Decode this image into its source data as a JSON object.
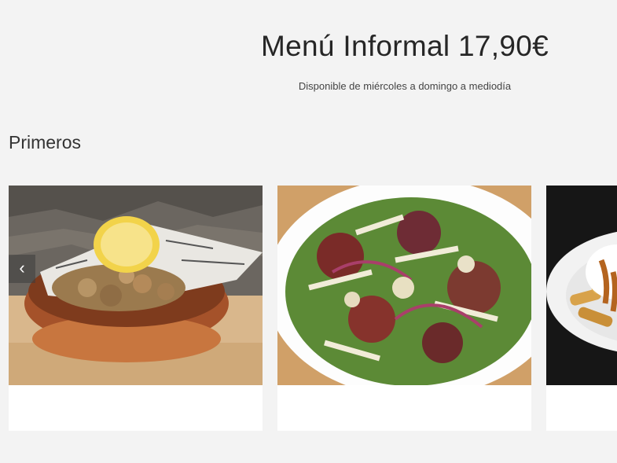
{
  "menu": {
    "title": "Menú Informal 17,90€",
    "subtitle": "Disponible de miércoles a domingo a mediodía"
  },
  "section": {
    "heading": "Primeros"
  },
  "carousel": {
    "prev_icon": "chevron-left-icon",
    "prev_glyph": "‹",
    "items": [
      {
        "label": "",
        "image": "fried-calamari-dish"
      },
      {
        "label": "",
        "image": "mixed-salad-with-ham"
      },
      {
        "label": "",
        "image": "fries-with-sauce"
      }
    ]
  }
}
